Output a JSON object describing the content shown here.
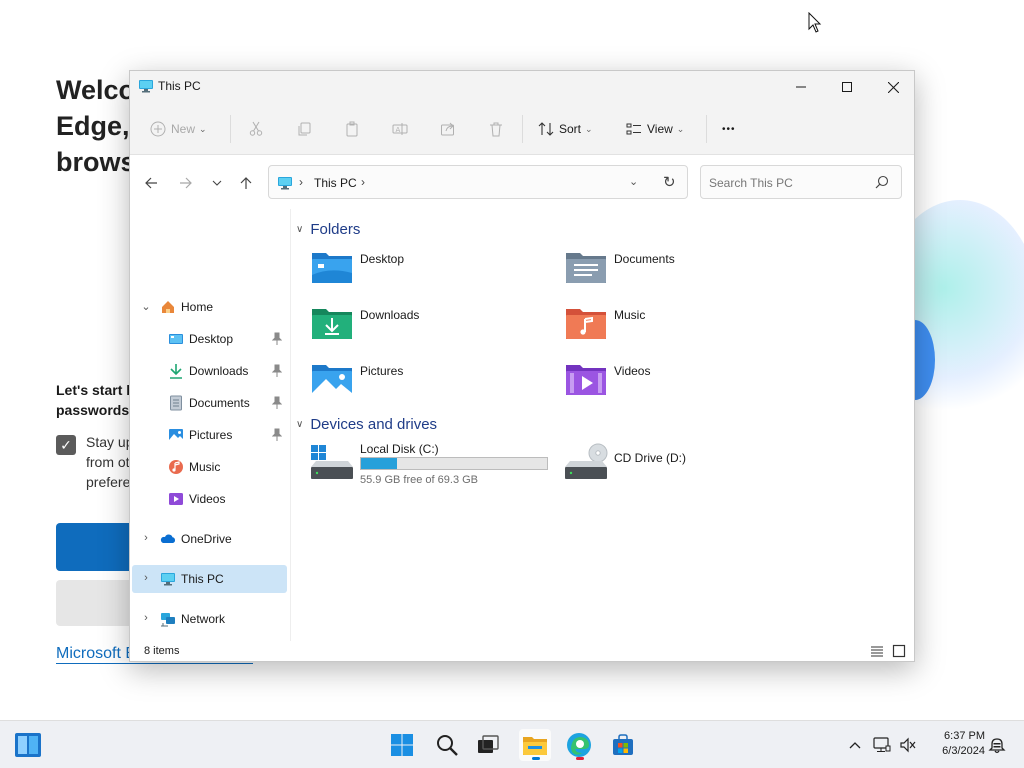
{
  "background_page": {
    "title_lines": [
      "Welco",
      "Edge,",
      "brows"
    ],
    "lead_lines": [
      "Let's start b",
      "passwords,"
    ],
    "sync_lines": [
      "Stay up",
      "from ot",
      "prefere"
    ],
    "link_text": "Microsoft Edge privacy statement"
  },
  "window": {
    "title": "This PC",
    "controls": {
      "minimize": "—",
      "maximize": "☐",
      "close": "✕"
    }
  },
  "command_bar": {
    "new_label": "New",
    "sort_label": "Sort",
    "view_label": "View",
    "more_label": "•••"
  },
  "address": {
    "crumb": "This PC",
    "search_placeholder": "Search This PC"
  },
  "nav_pane": {
    "home": "Home",
    "quick_access": [
      {
        "label": "Desktop",
        "icon": "desktop-icon",
        "pinned": true
      },
      {
        "label": "Downloads",
        "icon": "downloads-icon",
        "pinned": true
      },
      {
        "label": "Documents",
        "icon": "documents-icon",
        "pinned": true
      },
      {
        "label": "Pictures",
        "icon": "pictures-icon",
        "pinned": true
      },
      {
        "label": "Music",
        "icon": "music-icon",
        "pinned": false
      },
      {
        "label": "Videos",
        "icon": "videos-icon",
        "pinned": false
      }
    ],
    "onedrive": "OneDrive",
    "this_pc": "This PC",
    "network": "Network"
  },
  "content": {
    "folders_header": "Folders",
    "folders": [
      {
        "label": "Desktop",
        "icon": "desktop-folder-icon",
        "color": "#2c8fe0"
      },
      {
        "label": "Documents",
        "icon": "documents-folder-icon",
        "color": "#7d93a8"
      },
      {
        "label": "Downloads",
        "icon": "downloads-folder-icon",
        "color": "#1ea672"
      },
      {
        "label": "Music",
        "icon": "music-folder-icon",
        "color": "#e96a4e"
      },
      {
        "label": "Pictures",
        "icon": "pictures-folder-icon",
        "color": "#2a8ee0"
      },
      {
        "label": "Videos",
        "icon": "videos-folder-icon",
        "color": "#8f4ad8"
      }
    ],
    "drives_header": "Devices and drives",
    "drives": [
      {
        "label": "Local Disk (C:)",
        "free_text": "55.9 GB free of 69.3 GB",
        "used_fraction": 0.193
      },
      {
        "label": "CD Drive (D:)"
      }
    ]
  },
  "status_bar": {
    "item_count": "8 items"
  },
  "taskbar": {
    "clock_time": "6:37 PM",
    "clock_date": "6/3/2024",
    "accent": "#0078d4"
  }
}
